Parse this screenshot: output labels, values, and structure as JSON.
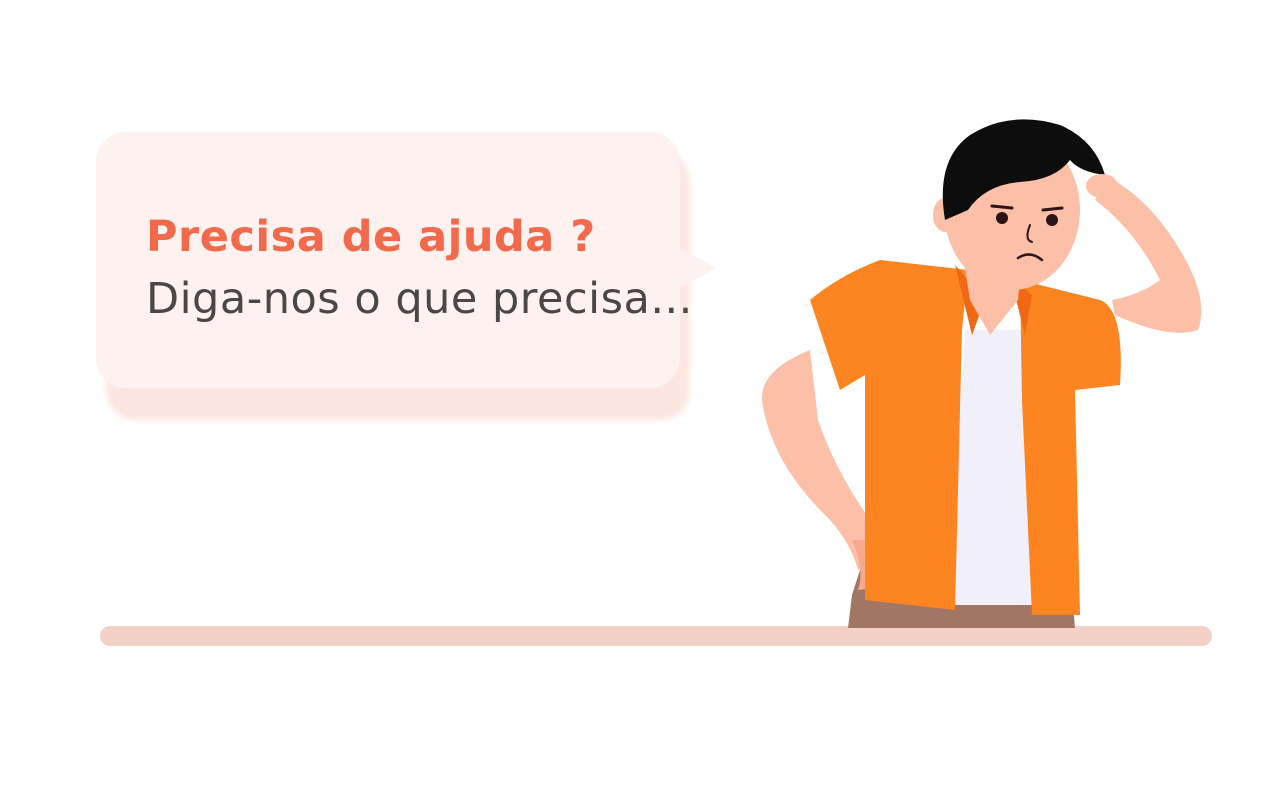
{
  "bubble": {
    "title": "Precisa de ajuda ?",
    "subtitle": "Diga-nos o que precisa..."
  },
  "colors": {
    "accent": "#f2694b",
    "text": "#4a4746",
    "bubble_bg": "#fdf2ef",
    "floor": "#f3d1c7",
    "shirt": "#fd8521",
    "skin": "#fcbfa8",
    "hair": "#0d0d0d",
    "pants": "#a17665"
  },
  "illustration": {
    "subject": "confused-man-icon"
  }
}
